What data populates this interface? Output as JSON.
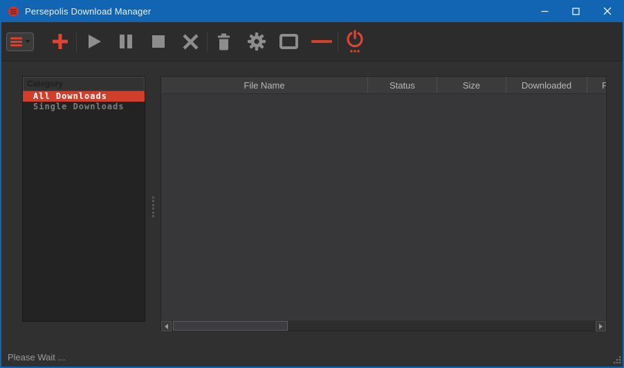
{
  "window": {
    "title": "Persepolis Download Manager",
    "controls": [
      {
        "name": "minimize",
        "icon": "minimize-icon"
      },
      {
        "name": "maximize",
        "icon": "maximize-icon"
      },
      {
        "name": "close",
        "icon": "close-icon"
      }
    ]
  },
  "toolbar": {
    "buttons": [
      {
        "name": "menu",
        "icon": "hamburger-menu-icon"
      },
      {
        "name": "add-download",
        "icon": "plus-icon"
      },
      {
        "name": "resume",
        "icon": "play-icon"
      },
      {
        "name": "pause",
        "icon": "pause-icon"
      },
      {
        "name": "stop",
        "icon": "stop-icon"
      },
      {
        "name": "remove",
        "icon": "x-icon"
      },
      {
        "name": "delete",
        "icon": "trash-icon"
      },
      {
        "name": "preferences",
        "icon": "gear-icon"
      },
      {
        "name": "video-window",
        "icon": "window-frame-icon"
      },
      {
        "name": "hide-menu",
        "icon": "horizontal-line-icon"
      },
      {
        "name": "exit",
        "icon": "power-icon"
      }
    ]
  },
  "sidebar": {
    "header": "Category",
    "items": [
      {
        "label": "All Downloads",
        "selected": true
      },
      {
        "label": "Single Downloads",
        "selected": false
      }
    ]
  },
  "table": {
    "columns": [
      {
        "label": "File Name"
      },
      {
        "label": "Status"
      },
      {
        "label": "Size"
      },
      {
        "label": "Downloaded"
      },
      {
        "label": "Percent"
      }
    ],
    "rows": []
  },
  "statusbar": {
    "text": "Please Wait ..."
  },
  "colors": {
    "titlebar_blue": "#1165b2",
    "accent_red": "#d8402e",
    "selected_red": "#d23e2c",
    "icon_gray": "#8d8d8d"
  }
}
